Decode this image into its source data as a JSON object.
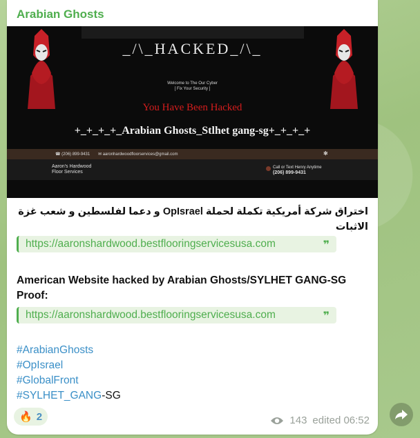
{
  "message": {
    "sender": "Arabian Ghosts",
    "media": {
      "hacked_title": "_/\\_HACKED_/\\_",
      "welcome_line1": "Welcome to The Our Cyber",
      "welcome_line2": "[ Fix Your Security ]",
      "headline": "You Have Been Hacked",
      "gang_line": "+_+_+_+_Arabian Ghosts_Stlhet gang-sg+_+_+_+",
      "info_phone": "(206) 899-9431",
      "info_email": "aaronhardwoodfloorservices@gmail.com",
      "business_line1": "Aaron's Hardwood",
      "business_line2": "Floor Services",
      "call_label": "Call or Text Henry Anytime",
      "call_phone": "(206) 899-9431"
    },
    "arabic_text": "اختراق شركة أمريكية تكملة لحملة OpIsrael و دعما لفلسطين و شعب غزة الاثبات",
    "link1": "https://aaronshardwood.bestflooringservicesusa.com",
    "english_text_line1": "American Website hacked by Arabian Ghosts/SYLHET GANG-SG",
    "english_text_line2": "Proof:",
    "link2": "https://aaronshardwood.bestflooringservicesusa.com",
    "hashtags": [
      "#ArabianGhosts",
      "#OpIsrael",
      "#GlobalFront",
      "#SYLHET_GANG"
    ],
    "last_tag_suffix": "-SG",
    "reaction": {
      "emoji": "🔥",
      "count": "2"
    },
    "views": "143",
    "edited_label": "edited 06:52"
  }
}
